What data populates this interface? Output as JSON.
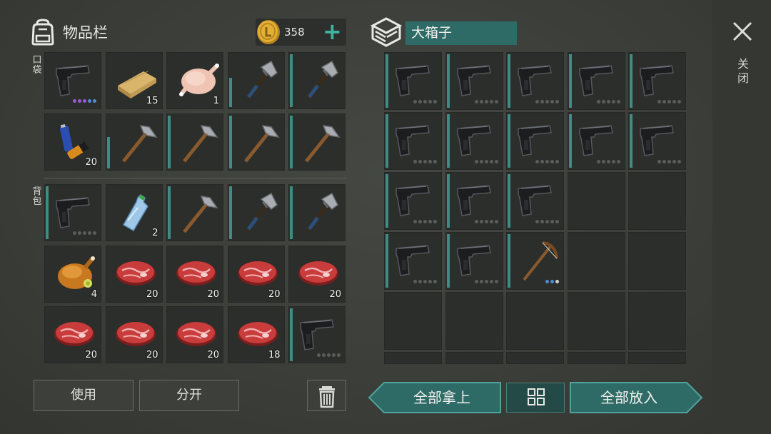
{
  "inventory": {
    "title": "物品栏",
    "coins": "358",
    "add_label": "+",
    "pocket_label": "口袋",
    "backpack_label": "背包",
    "pocket_slots": [
      {
        "item": "pistol",
        "dots": [
          "pur",
          "pur",
          "pur",
          "blu",
          "blu"
        ]
      },
      {
        "item": "wood-plank",
        "qty": "15"
      },
      {
        "item": "raw-chicken",
        "qty": "1"
      },
      {
        "item": "hatchet",
        "bar": 0.55
      },
      {
        "item": "hatchet",
        "bar": 1.0
      },
      {
        "item": "batteries",
        "qty": "20"
      },
      {
        "item": "pickaxe-hammer",
        "bar": 0.6
      },
      {
        "item": "pickaxe-hammer",
        "bar": 1.0
      },
      {
        "item": "pickaxe-hammer",
        "bar": 1.0
      },
      {
        "item": "pickaxe-hammer",
        "bar": 1.0
      }
    ],
    "backpack_slots": [
      {
        "item": "pistol",
        "bar": 1.0,
        "dots": [
          "g",
          "g",
          "g",
          "g",
          "g"
        ]
      },
      {
        "item": "water-bottle",
        "qty": "2"
      },
      {
        "item": "pickaxe-hammer",
        "bar": 1.0
      },
      {
        "item": "hatchet",
        "bar": 1.0
      },
      {
        "item": "hatchet",
        "bar": 1.0
      },
      {
        "item": "roast-chicken",
        "qty": "4"
      },
      {
        "item": "steak",
        "qty": "20"
      },
      {
        "item": "steak",
        "qty": "20"
      },
      {
        "item": "steak",
        "qty": "20"
      },
      {
        "item": "steak",
        "qty": "20"
      },
      {
        "item": "steak",
        "qty": "20"
      },
      {
        "item": "steak",
        "qty": "20"
      },
      {
        "item": "steak",
        "qty": "20"
      },
      {
        "item": "steak",
        "qty": "18"
      },
      {
        "item": "pistol",
        "bar": 1.0,
        "dots": [
          "g",
          "g",
          "g",
          "g",
          "g"
        ]
      }
    ],
    "use_button": "使用",
    "split_button": "分开"
  },
  "container": {
    "title": "大箱子",
    "close_label": "关闭",
    "take_all": "全部拿上",
    "put_all": "全部放入",
    "slots": [
      "pistol",
      "pistol",
      "pistol",
      "pistol",
      "pistol",
      "pistol",
      "pistol",
      "pistol",
      "pistol",
      "pistol",
      "pistol",
      "pistol",
      "pistol",
      "",
      "",
      "pistol",
      "pistol",
      "crossbow",
      "",
      "",
      "",
      "",
      "",
      "",
      "",
      "",
      "",
      "",
      "",
      ""
    ]
  },
  "colors": {
    "accent": "#3e8c86",
    "button_teal": "#3a7d77",
    "coin": "#d9a52a"
  }
}
